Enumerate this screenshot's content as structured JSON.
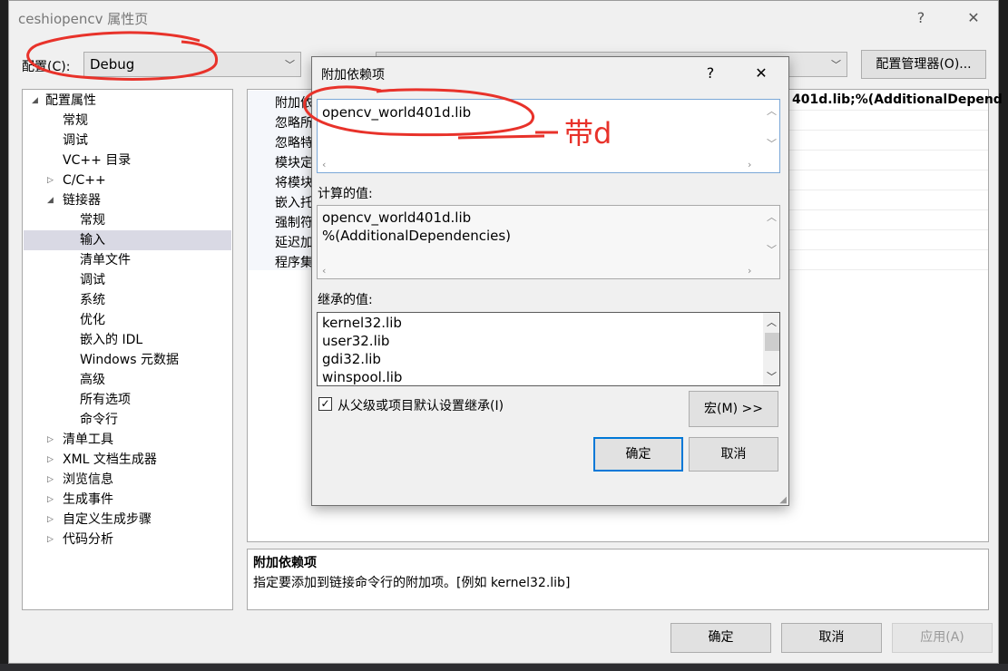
{
  "window": {
    "title": "ceshiopencv 属性页",
    "help_icon": "?",
    "close_icon": "✕"
  },
  "toolbar": {
    "config_label": "配置(C):",
    "config_value": "Debug",
    "config_manager_label": "配置管理器(O)..."
  },
  "tree": {
    "items": [
      {
        "label": "配置属性",
        "tri": "◢"
      },
      {
        "label": "常规"
      },
      {
        "label": "调试"
      },
      {
        "label": "VC++ 目录"
      },
      {
        "label": "C/C++",
        "tri": "▷"
      },
      {
        "label": "链接器",
        "tri": "◢"
      },
      {
        "label": "常规"
      },
      {
        "label": "输入"
      },
      {
        "label": "清单文件"
      },
      {
        "label": "调试"
      },
      {
        "label": "系统"
      },
      {
        "label": "优化"
      },
      {
        "label": "嵌入的 IDL"
      },
      {
        "label": "Windows 元数据"
      },
      {
        "label": "高级"
      },
      {
        "label": "所有选项"
      },
      {
        "label": "命令行"
      },
      {
        "label": "清单工具",
        "tri": "▷"
      },
      {
        "label": "XML 文档生成器",
        "tri": "▷"
      },
      {
        "label": "浏览信息",
        "tri": "▷"
      },
      {
        "label": "生成事件",
        "tri": "▷"
      },
      {
        "label": "自定义生成步骤",
        "tri": "▷"
      },
      {
        "label": "代码分析",
        "tri": "▷"
      }
    ]
  },
  "grid": {
    "rows": [
      {
        "name": "附加依",
        "value": "401d.lib;%(AdditionalDepend"
      },
      {
        "name": "忽略所",
        "value": ""
      },
      {
        "name": "忽略特",
        "value": ""
      },
      {
        "name": "模块定",
        "value": ""
      },
      {
        "name": "将模块",
        "value": ""
      },
      {
        "name": "嵌入托",
        "value": ""
      },
      {
        "name": "强制符",
        "value": ""
      },
      {
        "name": "延迟加",
        "value": ""
      },
      {
        "name": "程序集",
        "value": ""
      }
    ]
  },
  "description": {
    "title": "附加依赖项",
    "text": "指定要添加到链接命令行的附加项。[例如 kernel32.lib]"
  },
  "buttons": {
    "ok": "确定",
    "cancel": "取消",
    "apply": "应用(A)"
  },
  "dialog": {
    "title": "附加依赖项",
    "help_icon": "?",
    "close_icon": "✕",
    "input_lines": [
      "opencv_world401d.lib"
    ],
    "computed_label": "计算的值:",
    "computed_lines": [
      "opencv_world401d.lib",
      "%(AdditionalDependencies)"
    ],
    "inherited_label": "继承的值:",
    "inherited_lines": [
      "kernel32.lib",
      "user32.lib",
      "gdi32.lib",
      "winspool.lib"
    ],
    "inherit_checkbox_label": "从父级或项目默认设置继承(I)",
    "inherit_checked": "✓",
    "macro_button": "宏(M) >>",
    "ok": "确定",
    "cancel": "取消"
  },
  "annotation": {
    "text": "带d",
    "color": "#e8322a"
  }
}
